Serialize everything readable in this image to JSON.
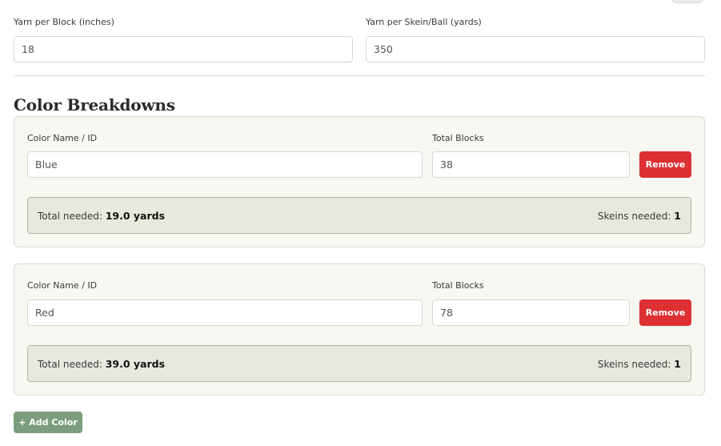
{
  "settings": {
    "yarn_per_block_label": "Yarn per Block (inches)",
    "yarn_per_block_value": "18",
    "yarn_per_skein_label": "Yarn per Skein/Ball (yards)",
    "yarn_per_skein_value": "350"
  },
  "breakdowns": {
    "title": "Color Breakdowns",
    "name_label": "Color Name / ID",
    "blocks_label": "Total Blocks",
    "remove_label": "Remove",
    "total_needed_label": "Total needed:",
    "skeins_needed_label": "Skeins needed:",
    "items": [
      {
        "name": "Blue",
        "blocks": "38",
        "total_needed": "19.0 yards",
        "skeins_needed": "1"
      },
      {
        "name": "Red",
        "blocks": "78",
        "total_needed": "39.0 yards",
        "skeins_needed": "1"
      }
    ],
    "add_label": "+ Add Color"
  },
  "colors": {
    "remove_button": "#dc3033",
    "add_button": "#7c9e7e",
    "card_background": "#f8f7f2",
    "summary_background": "#e7e9df",
    "summary_border": "#a9bb9f"
  }
}
